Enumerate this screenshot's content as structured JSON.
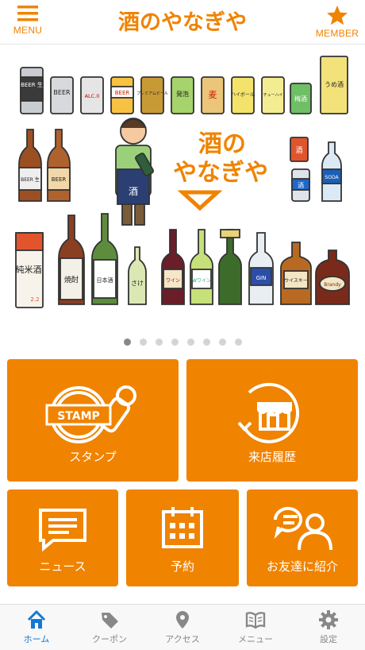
{
  "header": {
    "menu_label": "MENU",
    "member_label": "MEMBER",
    "logo_text": "酒のやなぎや",
    "accent": "#f08300"
  },
  "banner": {
    "logo_top": "酒の",
    "logo_bottom": "やなぎや",
    "apron_text": "酒",
    "row1": [
      "BEER 生",
      "BEER",
      "ALC.0",
      "BEER",
      "プレミアムビール",
      "発泡",
      "麦",
      "ハイボール",
      "チューハイ",
      "梅酒",
      "うめ酒"
    ],
    "row2": [
      "BEER 生",
      "BEER",
      "酒",
      "酒",
      "SODA"
    ],
    "row3": [
      "純米酒",
      "焼酎",
      "日本酒",
      "さけ",
      "ワイン",
      "Wワイン",
      "GIN",
      "ウイスキー",
      "Brandy"
    ],
    "carton_tag": "2.2",
    "page_count": 8,
    "active_page": 1
  },
  "tiles": {
    "stamp": {
      "label": "スタンプ",
      "icon_text": "STAMP"
    },
    "history": {
      "label": "来店履歴"
    },
    "news": {
      "label": "ニュース"
    },
    "reserve": {
      "label": "予約"
    },
    "invite": {
      "label": "お友達に紹介"
    },
    "color": "#f08300"
  },
  "tabbar": {
    "items": [
      {
        "label": "ホーム",
        "icon": "home-icon",
        "active": true
      },
      {
        "label": "クーポン",
        "icon": "coupon-tag-icon",
        "active": false
      },
      {
        "label": "アクセス",
        "icon": "map-pin-icon",
        "active": false
      },
      {
        "label": "メニュー",
        "icon": "menu-book-icon",
        "active": false
      },
      {
        "label": "設定",
        "icon": "gear-icon",
        "active": false
      }
    ],
    "active_color": "#1479d4",
    "inactive_color": "#888888"
  }
}
